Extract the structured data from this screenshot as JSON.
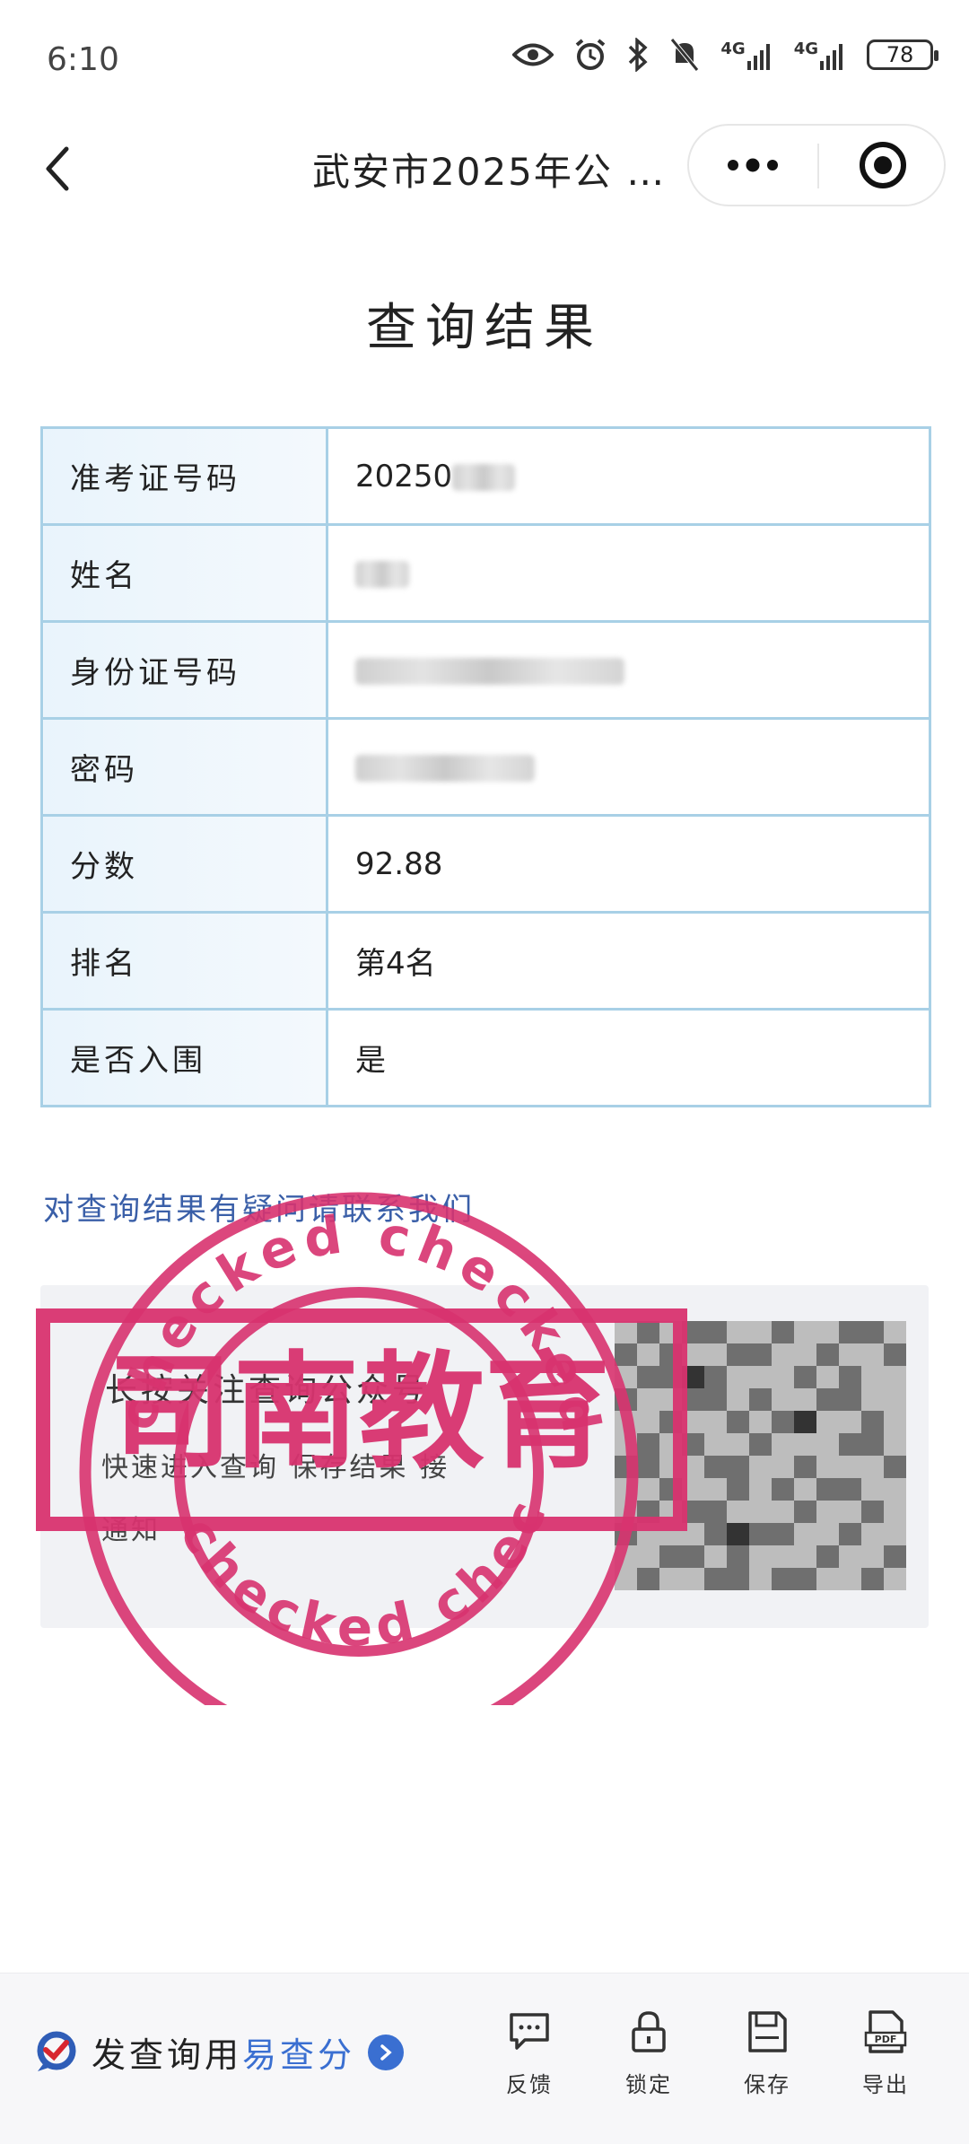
{
  "status_bar": {
    "time": "6:10",
    "network_1": "4G",
    "network_2": "4G",
    "battery": "78"
  },
  "nav": {
    "title": "武安市2025年公 …"
  },
  "page": {
    "title": "查询结果"
  },
  "result_rows": [
    {
      "label": "准考证号码",
      "value": "20250"
    },
    {
      "label": "姓名",
      "value": ""
    },
    {
      "label": "身份证号码",
      "value": ""
    },
    {
      "label": "密码",
      "value": ""
    },
    {
      "label": "分数",
      "value": "92.88"
    },
    {
      "label": "排名",
      "value": "第4名"
    },
    {
      "label": "是否入围",
      "value": "是"
    }
  ],
  "contact_text": "对查询结果有疑问请联系我们",
  "promo": {
    "line1": "长按关注查询公众号",
    "line2": "快速进入查询 保存结果 接",
    "line3": "通知"
  },
  "stamp": {
    "text": "司南教育",
    "ring": "checked",
    "color": "#d8336f"
  },
  "bottom_bar": {
    "brand_prefix": "发查询用",
    "brand_name": "易查分",
    "actions": [
      {
        "label": "反馈",
        "icon": "chat-icon"
      },
      {
        "label": "锁定",
        "icon": "lock-icon"
      },
      {
        "label": "保存",
        "icon": "save-icon"
      },
      {
        "label": "导出",
        "icon": "pdf-icon"
      }
    ],
    "pdf_icon_text": "PDF"
  },
  "colors": {
    "table_border": "#a8d0e6",
    "label_bg": "#e9f4fc",
    "link_blue": "#3a5fa8",
    "brand_blue": "#3a6fd1"
  }
}
